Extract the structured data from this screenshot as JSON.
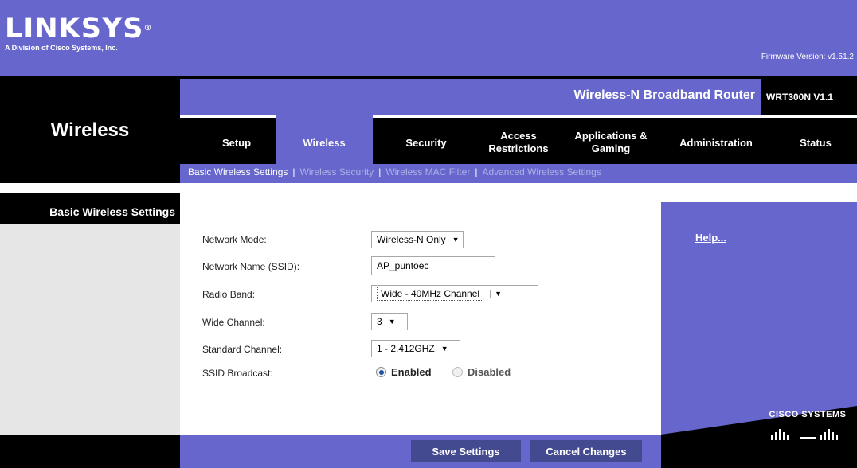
{
  "header": {
    "logo_text": "LINKSYS",
    "logo_reg": "®",
    "logo_subtitle": "A Division of Cisco Systems, Inc.",
    "firmware": "Firmware Version: v1.51.2",
    "product_name": "Wireless-N Broadband Router",
    "model": "WRT300N V1.1"
  },
  "page_title": "Wireless",
  "tabs": [
    {
      "label": "Setup"
    },
    {
      "label": "Wireless"
    },
    {
      "label": "Security"
    },
    {
      "label": "Access Restrictions"
    },
    {
      "label": "Applications & Gaming"
    },
    {
      "label": "Administration"
    },
    {
      "label": "Status"
    }
  ],
  "active_tab": "Wireless",
  "subnav": [
    {
      "label": "Basic Wireless Settings"
    },
    {
      "label": "Wireless Security"
    },
    {
      "label": "Wireless MAC Filter"
    },
    {
      "label": "Advanced Wireless Settings"
    }
  ],
  "section_label": "Basic Wireless Settings",
  "form": {
    "network_mode_label": "Network Mode:",
    "network_mode_value": "Wireless-N Only",
    "ssid_label": "Network Name (SSID):",
    "ssid_value": "AP_puntoec",
    "radio_band_label": "Radio Band:",
    "radio_band_value": "Wide - 40MHz Channel",
    "wide_channel_label": "Wide Channel:",
    "wide_channel_value": "3",
    "standard_channel_label": "Standard Channel:",
    "standard_channel_value": "1 - 2.412GHZ",
    "ssid_broadcast_label": "SSID Broadcast:",
    "ssid_broadcast_options": [
      "Enabled",
      "Disabled"
    ],
    "ssid_broadcast_selected": "Enabled"
  },
  "help_link": "Help...",
  "buttons": {
    "save": "Save Settings",
    "cancel": "Cancel Changes"
  },
  "cisco_logo": "CISCO SYSTEMS",
  "colors": {
    "brand_purple": "#6666cc",
    "dark": "#000000",
    "button": "#434a8f"
  }
}
